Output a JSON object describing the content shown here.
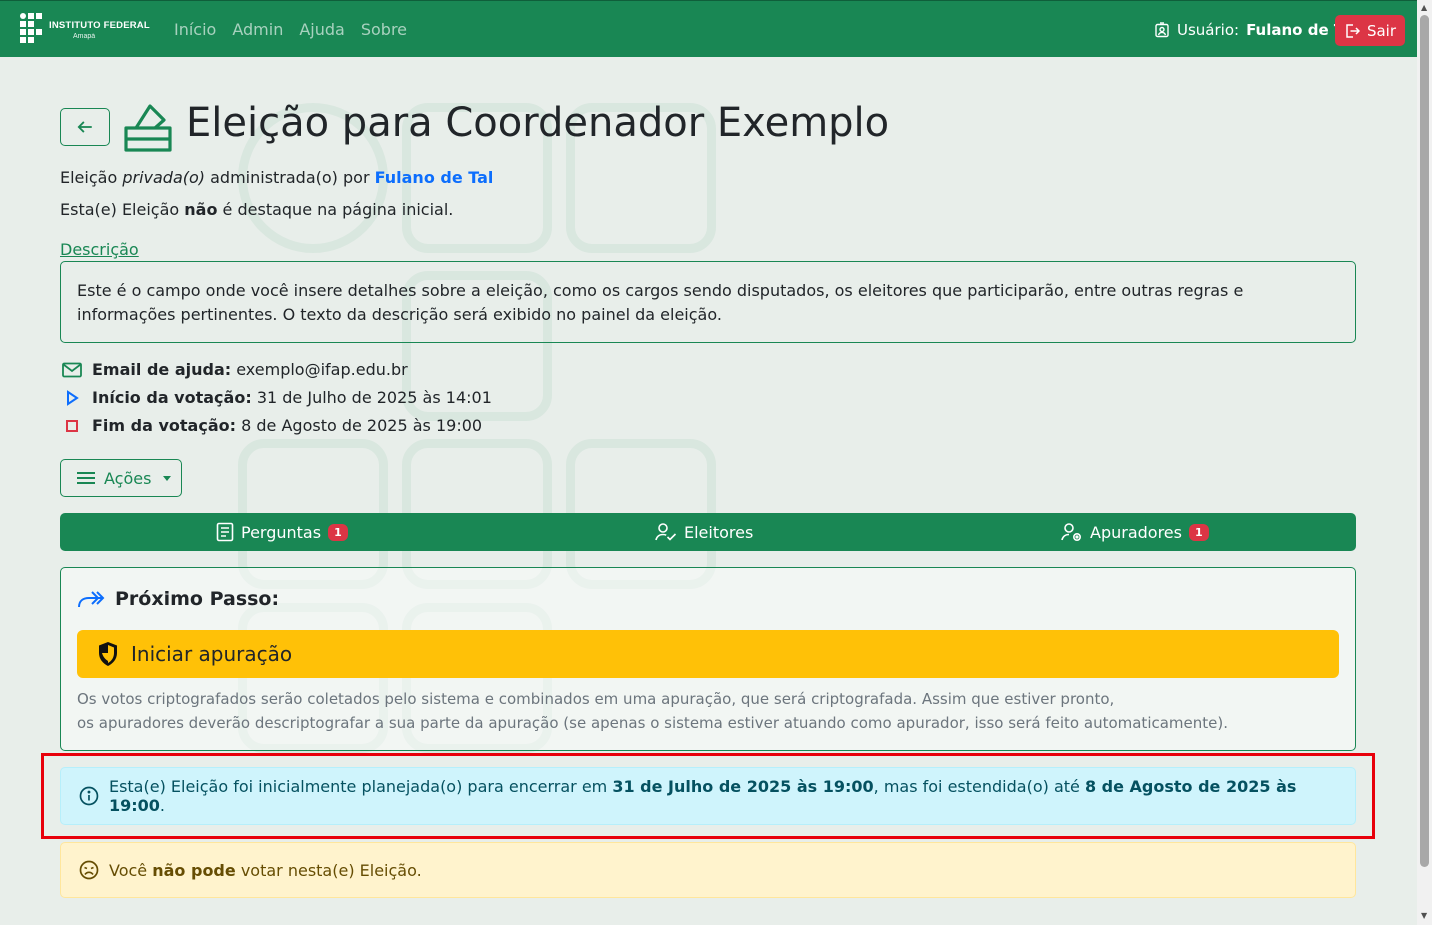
{
  "navbar": {
    "brand_name": "INSTITUTO FEDERAL",
    "brand_campus": "Amapá",
    "links": [
      "Início",
      "Admin",
      "Ajuda",
      "Sobre"
    ],
    "user_label": "Usuário:",
    "user_name": "Fulano de Tal",
    "logout_label": "Sair"
  },
  "election": {
    "title": "Eleição para Coordenador Exemplo",
    "line1_prefix": "Eleição",
    "line1_private": "privada(o)",
    "line1_mid": "administrada(o) por",
    "line1_admin": "Fulano de Tal",
    "line2_prefix": "Esta(e) Eleição",
    "line2_not": "não",
    "line2_suffix": "é destaque na página inicial.",
    "description_label": "Descrição",
    "description_text": "Este é o campo onde você insere detalhes sobre a eleição, como os cargos sendo disputados, os eleitores que participarão, entre outras regras e informações pertinentes. O texto da descrição será exibido no painel da eleição.",
    "help_email_label": "Email de ajuda:",
    "help_email": "exemplo@ifap.edu.br",
    "start_label": "Início da votação:",
    "start_value": "31 de Julho de 2025 às 14:01",
    "end_label": "Fim da votação:",
    "end_value": "8 de Agosto de 2025 às 19:00"
  },
  "actions_label": "Ações",
  "tabs": [
    {
      "label": "Perguntas",
      "badge": "1"
    },
    {
      "label": "Eleitores",
      "badge": ""
    },
    {
      "label": "Apuradores",
      "badge": "1"
    }
  ],
  "next_step": {
    "title": "Próximo Passo:",
    "button_label": "Iniciar apuração",
    "text_line1": "Os votos criptografados serão coletados pelo sistema e combinados em uma apuração, que será criptografada. Assim que estiver pronto,",
    "text_line2": "os apuradores deverão descriptografar a sua parte da apuração (se apenas o sistema estiver atuando como apurador, isso será feito automaticamente)."
  },
  "alert_info": {
    "prefix": "Esta(e) Eleição foi inicialmente planejada(o) para encerrar em",
    "original_end": "31 de Julho de 2025 às 19:00",
    "mid": ", mas foi estendida(o) até",
    "extended_end": "8 de Agosto de 2025 às 19:00",
    "suffix": "."
  },
  "alert_warn": {
    "prefix": "Você",
    "bold": "não pode",
    "suffix": "votar nesta(e) Eleição."
  },
  "colors": {
    "primary": "#198754",
    "danger": "#dc3545",
    "warning": "#ffc107",
    "info_bg": "#cff4fc",
    "link": "#0d6efd",
    "highlight_frame": "#e8000b"
  }
}
